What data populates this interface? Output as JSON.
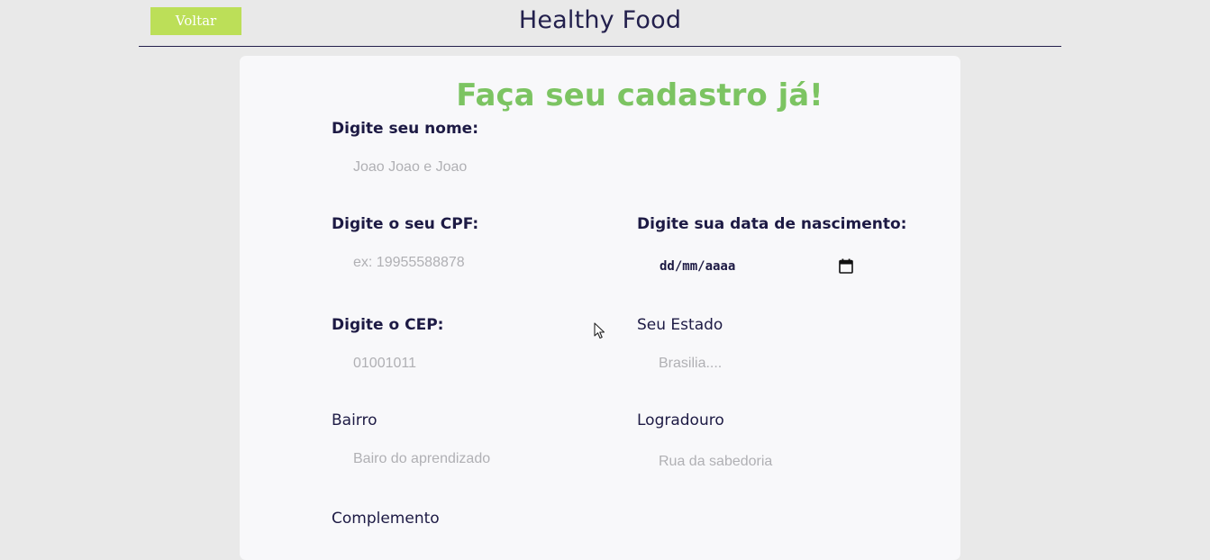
{
  "header": {
    "back_label": "Voltar",
    "title": "Healthy Food"
  },
  "form": {
    "title": "Faça seu cadastro já!",
    "fields": {
      "nome": {
        "label": "Digite seu nome:",
        "placeholder": "Joao Joao e Joao",
        "value": ""
      },
      "cpf": {
        "label": "Digite o seu CPF:",
        "placeholder": "ex: 19955588878",
        "value": ""
      },
      "nascimento": {
        "label": "Digite sua data de nascimento:",
        "value": "dd/mm/aaaa"
      },
      "cep": {
        "label": "Digite o CEP:",
        "placeholder": "01001011",
        "value": ""
      },
      "estado": {
        "label": "Seu Estado",
        "placeholder": "Brasilia....",
        "value": ""
      },
      "bairro": {
        "label": "Bairro",
        "placeholder": "Bairo do aprendizado",
        "value": ""
      },
      "logradouro": {
        "label": "Logradouro",
        "placeholder": "Rua da sabedoria",
        "value": ""
      },
      "complemento": {
        "label": "Complemento"
      }
    }
  },
  "icons": {
    "calendar": "calendar-icon",
    "cursor": "mouse-pointer-icon"
  },
  "colors": {
    "background": "#e9e9e9",
    "card": "#f8f8fa",
    "accent_green": "#7cc462",
    "button_green": "#bcdf58",
    "text_dark": "#1d1a44",
    "placeholder": "#b0b0b4"
  }
}
